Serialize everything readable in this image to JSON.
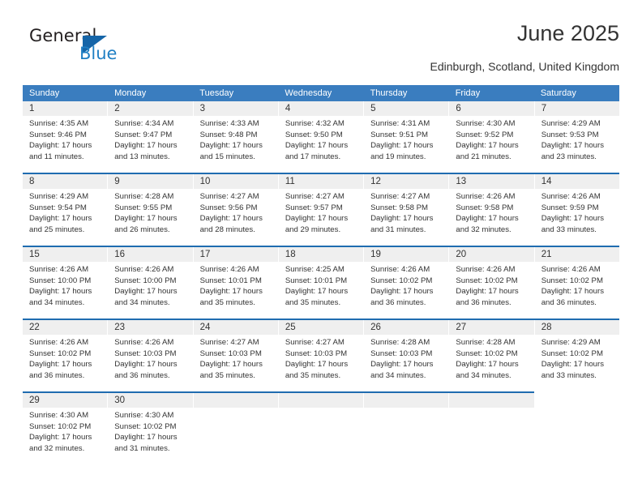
{
  "logo": {
    "word_top": "General",
    "word_bottom": "Blue",
    "triangle_color": "#1565a8",
    "blue_color": "#1f7fc4"
  },
  "header": {
    "title": "June 2025",
    "location": "Edinburgh, Scotland, United Kingdom"
  },
  "calendar": {
    "header_bg": "#3a7dbf",
    "row_separator_color": "#1f6cb0",
    "daynum_band_color": "#efefef",
    "weekdays": [
      "Sunday",
      "Monday",
      "Tuesday",
      "Wednesday",
      "Thursday",
      "Friday",
      "Saturday"
    ],
    "labels": {
      "sunrise": "Sunrise:",
      "sunset": "Sunset:",
      "daylight": "Daylight:"
    },
    "weeks": [
      [
        {
          "day": "1",
          "sunrise": "Sunrise: 4:35 AM",
          "sunset": "Sunset: 9:46 PM",
          "daylight_1": "Daylight: 17 hours",
          "daylight_2": "and 11 minutes."
        },
        {
          "day": "2",
          "sunrise": "Sunrise: 4:34 AM",
          "sunset": "Sunset: 9:47 PM",
          "daylight_1": "Daylight: 17 hours",
          "daylight_2": "and 13 minutes."
        },
        {
          "day": "3",
          "sunrise": "Sunrise: 4:33 AM",
          "sunset": "Sunset: 9:48 PM",
          "daylight_1": "Daylight: 17 hours",
          "daylight_2": "and 15 minutes."
        },
        {
          "day": "4",
          "sunrise": "Sunrise: 4:32 AM",
          "sunset": "Sunset: 9:50 PM",
          "daylight_1": "Daylight: 17 hours",
          "daylight_2": "and 17 minutes."
        },
        {
          "day": "5",
          "sunrise": "Sunrise: 4:31 AM",
          "sunset": "Sunset: 9:51 PM",
          "daylight_1": "Daylight: 17 hours",
          "daylight_2": "and 19 minutes."
        },
        {
          "day": "6",
          "sunrise": "Sunrise: 4:30 AM",
          "sunset": "Sunset: 9:52 PM",
          "daylight_1": "Daylight: 17 hours",
          "daylight_2": "and 21 minutes."
        },
        {
          "day": "7",
          "sunrise": "Sunrise: 4:29 AM",
          "sunset": "Sunset: 9:53 PM",
          "daylight_1": "Daylight: 17 hours",
          "daylight_2": "and 23 minutes."
        }
      ],
      [
        {
          "day": "8",
          "sunrise": "Sunrise: 4:29 AM",
          "sunset": "Sunset: 9:54 PM",
          "daylight_1": "Daylight: 17 hours",
          "daylight_2": "and 25 minutes."
        },
        {
          "day": "9",
          "sunrise": "Sunrise: 4:28 AM",
          "sunset": "Sunset: 9:55 PM",
          "daylight_1": "Daylight: 17 hours",
          "daylight_2": "and 26 minutes."
        },
        {
          "day": "10",
          "sunrise": "Sunrise: 4:27 AM",
          "sunset": "Sunset: 9:56 PM",
          "daylight_1": "Daylight: 17 hours",
          "daylight_2": "and 28 minutes."
        },
        {
          "day": "11",
          "sunrise": "Sunrise: 4:27 AM",
          "sunset": "Sunset: 9:57 PM",
          "daylight_1": "Daylight: 17 hours",
          "daylight_2": "and 29 minutes."
        },
        {
          "day": "12",
          "sunrise": "Sunrise: 4:27 AM",
          "sunset": "Sunset: 9:58 PM",
          "daylight_1": "Daylight: 17 hours",
          "daylight_2": "and 31 minutes."
        },
        {
          "day": "13",
          "sunrise": "Sunrise: 4:26 AM",
          "sunset": "Sunset: 9:58 PM",
          "daylight_1": "Daylight: 17 hours",
          "daylight_2": "and 32 minutes."
        },
        {
          "day": "14",
          "sunrise": "Sunrise: 4:26 AM",
          "sunset": "Sunset: 9:59 PM",
          "daylight_1": "Daylight: 17 hours",
          "daylight_2": "and 33 minutes."
        }
      ],
      [
        {
          "day": "15",
          "sunrise": "Sunrise: 4:26 AM",
          "sunset": "Sunset: 10:00 PM",
          "daylight_1": "Daylight: 17 hours",
          "daylight_2": "and 34 minutes."
        },
        {
          "day": "16",
          "sunrise": "Sunrise: 4:26 AM",
          "sunset": "Sunset: 10:00 PM",
          "daylight_1": "Daylight: 17 hours",
          "daylight_2": "and 34 minutes."
        },
        {
          "day": "17",
          "sunrise": "Sunrise: 4:26 AM",
          "sunset": "Sunset: 10:01 PM",
          "daylight_1": "Daylight: 17 hours",
          "daylight_2": "and 35 minutes."
        },
        {
          "day": "18",
          "sunrise": "Sunrise: 4:25 AM",
          "sunset": "Sunset: 10:01 PM",
          "daylight_1": "Daylight: 17 hours",
          "daylight_2": "and 35 minutes."
        },
        {
          "day": "19",
          "sunrise": "Sunrise: 4:26 AM",
          "sunset": "Sunset: 10:02 PM",
          "daylight_1": "Daylight: 17 hours",
          "daylight_2": "and 36 minutes."
        },
        {
          "day": "20",
          "sunrise": "Sunrise: 4:26 AM",
          "sunset": "Sunset: 10:02 PM",
          "daylight_1": "Daylight: 17 hours",
          "daylight_2": "and 36 minutes."
        },
        {
          "day": "21",
          "sunrise": "Sunrise: 4:26 AM",
          "sunset": "Sunset: 10:02 PM",
          "daylight_1": "Daylight: 17 hours",
          "daylight_2": "and 36 minutes."
        }
      ],
      [
        {
          "day": "22",
          "sunrise": "Sunrise: 4:26 AM",
          "sunset": "Sunset: 10:02 PM",
          "daylight_1": "Daylight: 17 hours",
          "daylight_2": "and 36 minutes."
        },
        {
          "day": "23",
          "sunrise": "Sunrise: 4:26 AM",
          "sunset": "Sunset: 10:03 PM",
          "daylight_1": "Daylight: 17 hours",
          "daylight_2": "and 36 minutes."
        },
        {
          "day": "24",
          "sunrise": "Sunrise: 4:27 AM",
          "sunset": "Sunset: 10:03 PM",
          "daylight_1": "Daylight: 17 hours",
          "daylight_2": "and 35 minutes."
        },
        {
          "day": "25",
          "sunrise": "Sunrise: 4:27 AM",
          "sunset": "Sunset: 10:03 PM",
          "daylight_1": "Daylight: 17 hours",
          "daylight_2": "and 35 minutes."
        },
        {
          "day": "26",
          "sunrise": "Sunrise: 4:28 AM",
          "sunset": "Sunset: 10:03 PM",
          "daylight_1": "Daylight: 17 hours",
          "daylight_2": "and 34 minutes."
        },
        {
          "day": "27",
          "sunrise": "Sunrise: 4:28 AM",
          "sunset": "Sunset: 10:02 PM",
          "daylight_1": "Daylight: 17 hours",
          "daylight_2": "and 34 minutes."
        },
        {
          "day": "28",
          "sunrise": "Sunrise: 4:29 AM",
          "sunset": "Sunset: 10:02 PM",
          "daylight_1": "Daylight: 17 hours",
          "daylight_2": "and 33 minutes."
        }
      ],
      [
        {
          "day": "29",
          "sunrise": "Sunrise: 4:30 AM",
          "sunset": "Sunset: 10:02 PM",
          "daylight_1": "Daylight: 17 hours",
          "daylight_2": "and 32 minutes."
        },
        {
          "day": "30",
          "sunrise": "Sunrise: 4:30 AM",
          "sunset": "Sunset: 10:02 PM",
          "daylight_1": "Daylight: 17 hours",
          "daylight_2": "and 31 minutes."
        },
        {
          "day": "",
          "sunrise": "",
          "sunset": "",
          "daylight_1": "",
          "daylight_2": ""
        },
        {
          "day": "",
          "sunrise": "",
          "sunset": "",
          "daylight_1": "",
          "daylight_2": ""
        },
        {
          "day": "",
          "sunrise": "",
          "sunset": "",
          "daylight_1": "",
          "daylight_2": ""
        },
        {
          "day": "",
          "sunrise": "",
          "sunset": "",
          "daylight_1": "",
          "daylight_2": ""
        },
        {
          "day": "",
          "sunrise": "",
          "sunset": "",
          "daylight_1": "",
          "daylight_2": ""
        }
      ]
    ]
  }
}
